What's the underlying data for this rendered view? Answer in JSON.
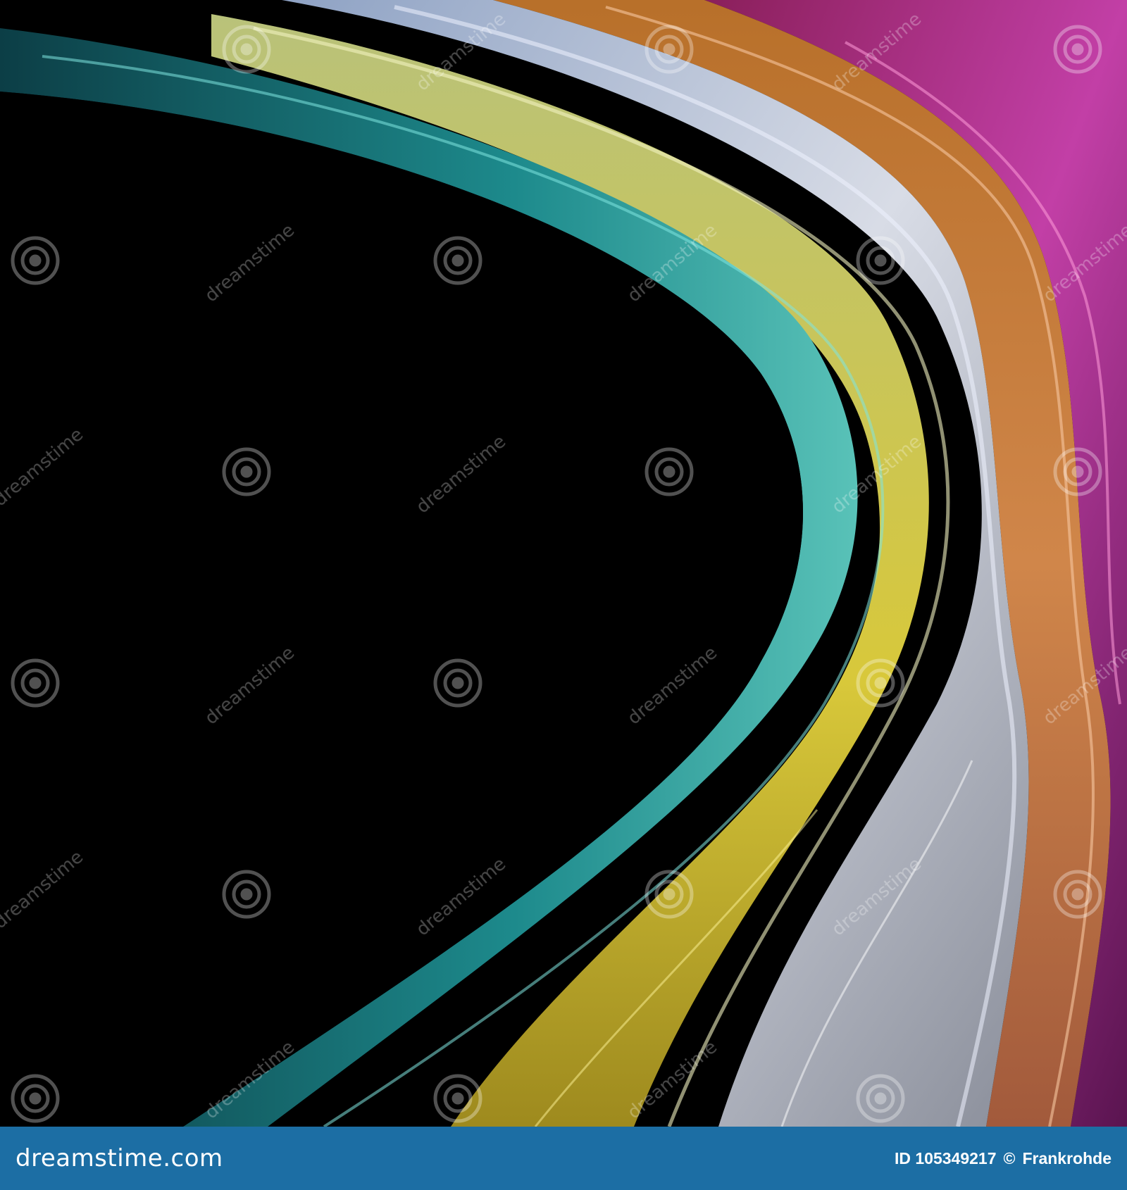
{
  "image": {
    "colors": {
      "background": "#000000",
      "footer_background": "#1c6ea4",
      "footer_text": "#ffffff",
      "watermark": "#ffffff"
    }
  },
  "watermark": {
    "text": "dreamstime",
    "icon": "dreamstime-spiral-logo-icon"
  },
  "footer": {
    "logo_text": "dreamstime.com",
    "image_id": "ID 105349217",
    "copyright_symbol": "©",
    "author": "Frankrohde"
  }
}
